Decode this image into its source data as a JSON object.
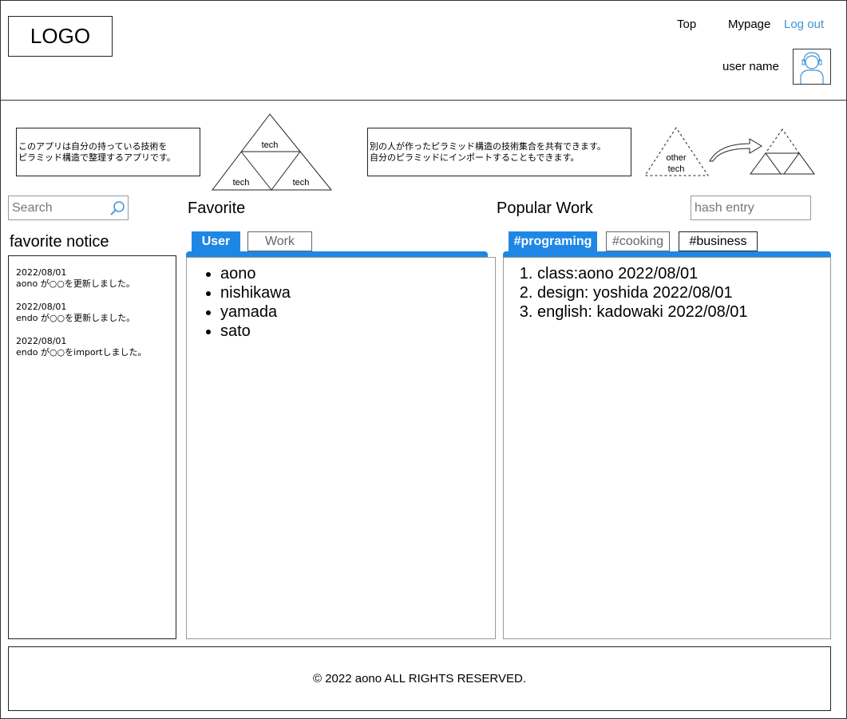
{
  "header": {
    "logo": "LOGO",
    "nav": {
      "top": "Top",
      "mypage": "Mypage",
      "logout": "Log out"
    },
    "user_name": "user name"
  },
  "intro": {
    "desc1_line1": "このアプリは自分の持っている技術を",
    "desc1_line2": "ピラミッド構造で整理するアプリです。",
    "desc2_line1": "別の人が作ったピラミッド構造の技術集合を共有できます。",
    "desc2_line2": "自分のピラミッドにインポートすることもできます。",
    "pyramid_labels": [
      "tech",
      "tech",
      "tech"
    ],
    "other_label_1": "other",
    "other_label_2": "tech"
  },
  "search": {
    "placeholder": "Search"
  },
  "hash": {
    "placeholder": "hash entry"
  },
  "favorite_notice": {
    "title": "favorite notice",
    "items": [
      {
        "date": "2022/08/01",
        "text": "aono が○○を更新しました。"
      },
      {
        "date": "2022/08/01",
        "text": "endo が○○を更新しました。"
      },
      {
        "date": "2022/08/01",
        "text": "endo が○○をimportしました。"
      }
    ]
  },
  "favorite": {
    "title": "Favorite",
    "tabs": [
      "User",
      "Work"
    ],
    "users": [
      "aono",
      "nishikawa",
      "yamada",
      "sato"
    ]
  },
  "popular": {
    "title": "Popular Work",
    "tabs": [
      "#programing",
      "#cooking",
      "#business"
    ],
    "items": [
      "class:aono 2022/08/01",
      "design: yoshida  2022/08/01",
      "english: kadowaki 2022/08/01"
    ]
  },
  "footer": {
    "copyright": "© 2022 aono ALL RIGHTS RESERVED."
  },
  "colors": {
    "accent": "#1e87e5",
    "link": "#3d95d8"
  }
}
